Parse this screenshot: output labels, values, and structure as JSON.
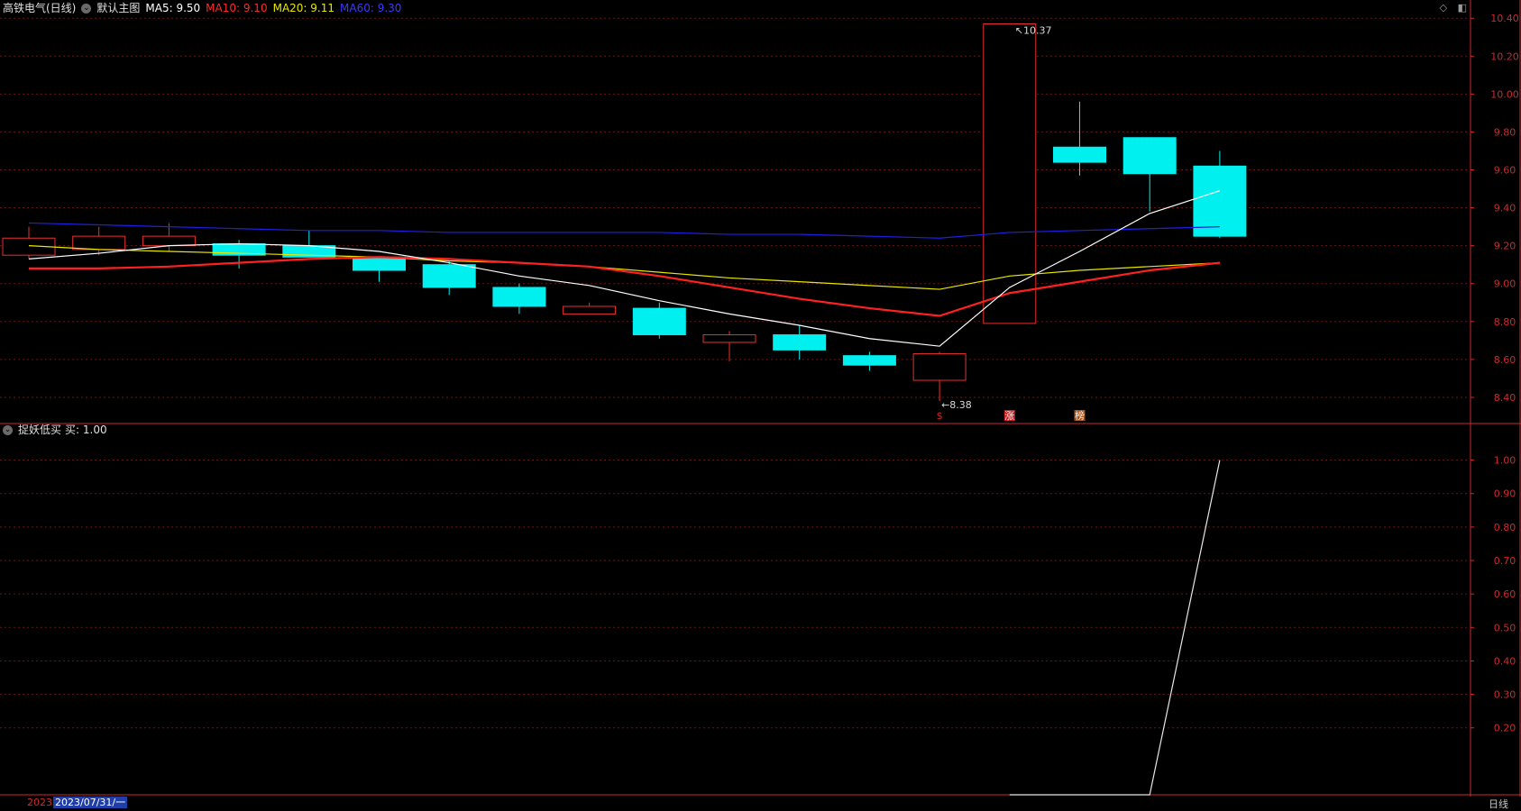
{
  "header": {
    "stock": "高铁电气(日线)",
    "template": "默认主图",
    "ma5": "MA5: 9.50",
    "ma10": "MA10: 9.10",
    "ma20": "MA20: 9.11",
    "ma60": "MA60: 9.30"
  },
  "indicator": {
    "name": "捉妖低买",
    "value": "买: 1.00"
  },
  "footer": {
    "year": "2023",
    "date": "2023/07/31/一",
    "period": "日线"
  },
  "colors": {
    "up": "#e8302c",
    "down": "#00f0f0",
    "grid": "#6a1414",
    "ma5": "#ffffff",
    "ma10": "#ff2020",
    "ma20": "#e8e800",
    "ma60": "#2020e0",
    "axis": "#d0282c"
  },
  "chart_data": [
    {
      "type": "candlestick",
      "ylim": [
        8.3,
        10.42
      ],
      "yticks": [
        "10.40",
        "10.20",
        "10.00",
        "9.80",
        "9.60",
        "9.40",
        "9.20",
        "9.00",
        "8.80",
        "8.60",
        "8.40"
      ],
      "candles": [
        {
          "o": 9.15,
          "h": 9.3,
          "l": 9.13,
          "c": 9.24
        },
        {
          "o": 9.18,
          "h": 9.3,
          "l": 9.15,
          "c": 9.25
        },
        {
          "o": 9.2,
          "h": 9.32,
          "l": 9.17,
          "c": 9.25
        },
        {
          "o": 9.21,
          "h": 9.23,
          "l": 9.08,
          "c": 9.15
        },
        {
          "o": 9.2,
          "h": 9.28,
          "l": 9.14,
          "c": 9.14
        },
        {
          "o": 9.14,
          "h": 9.14,
          "l": 9.01,
          "c": 9.07
        },
        {
          "o": 9.1,
          "h": 9.12,
          "l": 8.94,
          "c": 8.98
        },
        {
          "o": 8.98,
          "h": 9.0,
          "l": 8.84,
          "c": 8.88
        },
        {
          "o": 8.84,
          "h": 8.9,
          "l": 8.84,
          "c": 8.88
        },
        {
          "o": 8.87,
          "h": 8.9,
          "l": 8.71,
          "c": 8.73
        },
        {
          "o": 8.69,
          "h": 8.75,
          "l": 8.59,
          "c": 8.73
        },
        {
          "o": 8.73,
          "h": 8.78,
          "l": 8.6,
          "c": 8.65
        },
        {
          "o": 8.62,
          "h": 8.64,
          "l": 8.54,
          "c": 8.57
        },
        {
          "o": 8.49,
          "h": 8.64,
          "l": 8.38,
          "c": 8.63
        },
        {
          "o": 8.79,
          "h": 10.37,
          "l": 8.79,
          "c": 10.37
        },
        {
          "o": 9.72,
          "h": 9.96,
          "l": 9.57,
          "c": 9.64
        },
        {
          "o": 9.77,
          "h": 9.77,
          "l": 9.38,
          "c": 9.58
        },
        {
          "o": 9.62,
          "h": 9.7,
          "l": 9.24,
          "c": 9.25
        }
      ],
      "ma5": [
        9.13,
        9.16,
        9.2,
        9.21,
        9.2,
        9.17,
        9.11,
        9.04,
        8.99,
        8.91,
        8.84,
        8.78,
        8.71,
        8.67,
        8.98,
        9.17,
        9.37,
        9.49
      ],
      "ma10": [
        9.08,
        9.08,
        9.09,
        9.11,
        9.13,
        9.14,
        9.13,
        9.11,
        9.09,
        9.04,
        8.98,
        8.92,
        8.87,
        8.83,
        8.95,
        9.01,
        9.07,
        9.11
      ],
      "ma20": [
        9.2,
        9.18,
        9.17,
        9.16,
        9.15,
        9.14,
        9.12,
        9.11,
        9.09,
        9.06,
        9.03,
        9.01,
        8.99,
        8.97,
        9.04,
        9.07,
        9.09,
        9.11
      ],
      "ma60": [
        9.32,
        9.31,
        9.3,
        9.29,
        9.28,
        9.28,
        9.27,
        9.27,
        9.27,
        9.27,
        9.26,
        9.26,
        9.25,
        9.24,
        9.27,
        9.28,
        9.29,
        9.3
      ],
      "annotations": {
        "high_label": "10.37",
        "low_label": "8.38",
        "markers": [
          {
            "index": 13,
            "text": "$"
          },
          {
            "index": 14,
            "text": "涨"
          },
          {
            "index": 15,
            "text": "榜"
          }
        ]
      }
    },
    {
      "type": "line",
      "title": "捉妖低买",
      "ylim": [
        0,
        1.05
      ],
      "yticks": [
        "1.00",
        "0.90",
        "0.80",
        "0.70",
        "0.60",
        "0.50",
        "0.40",
        "0.30",
        "0.20"
      ],
      "series": [
        {
          "name": "买",
          "start_index": 14,
          "values": [
            0,
            0,
            0,
            1.0
          ]
        }
      ]
    }
  ]
}
